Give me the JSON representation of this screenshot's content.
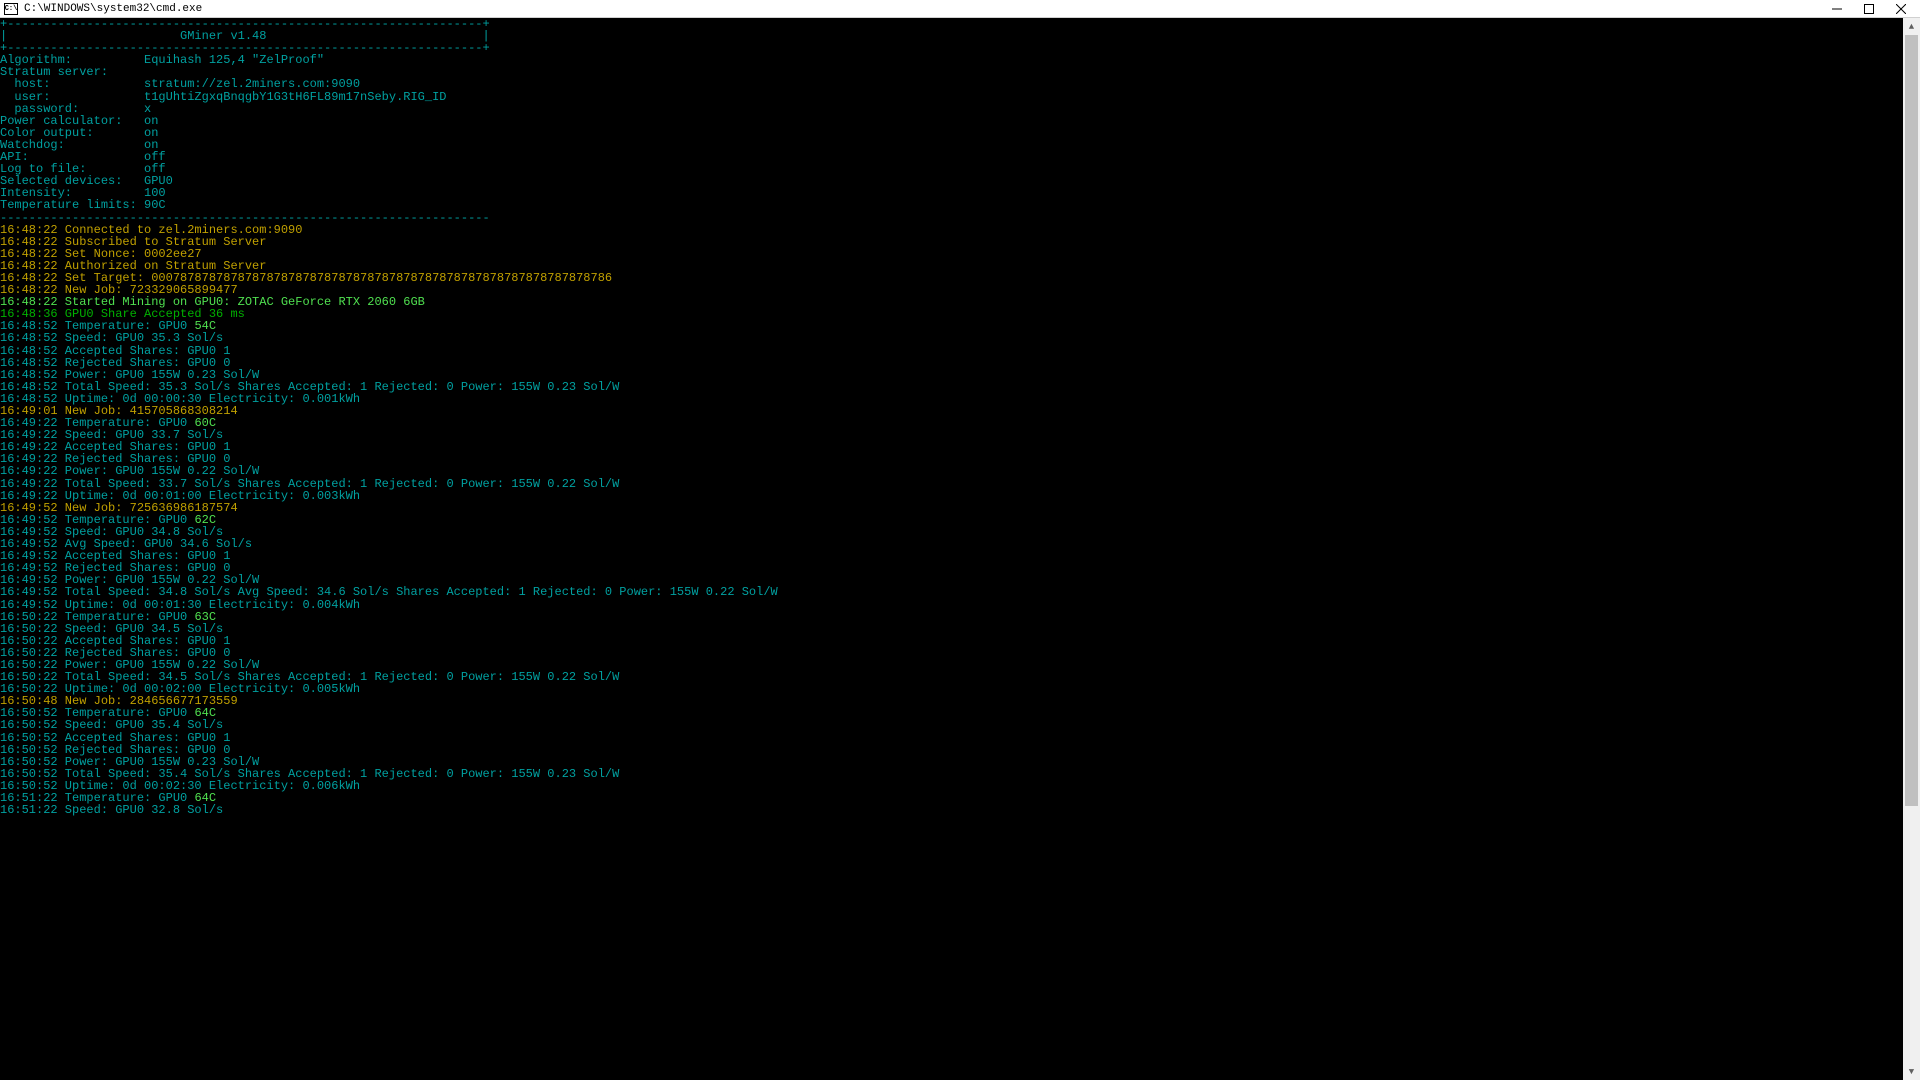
{
  "titlebar": {
    "icon_text": "C:\\",
    "title": "C:\\WINDOWS\\system32\\cmd.exe"
  },
  "banner": {
    "sep": "+------------------------------------------------------------------+",
    "mid": "|                        GMiner v1.48                              |"
  },
  "config_sep_top": "+------------------------------------------------------------------+",
  "config": [
    [
      "Algorithm:          ",
      "Equihash 125,4 \"ZelProof\""
    ],
    [
      "Stratum server:",
      ""
    ],
    [
      "  host:             ",
      "stratum://zel.2miners.com:9090"
    ],
    [
      "  user:             ",
      "t1gUhtiZgxqBnqgbY1G3tH6FL89m17nSeby.RIG_ID"
    ],
    [
      "  password:         ",
      "x"
    ],
    [
      "Power calculator:   ",
      "on"
    ],
    [
      "Color output:       ",
      "on"
    ],
    [
      "Watchdog:           ",
      "on"
    ],
    [
      "API:                ",
      "off"
    ],
    [
      "Log to file:        ",
      "off"
    ],
    [
      "Selected devices:   ",
      "GPU0"
    ],
    [
      "Intensity:          ",
      "100"
    ],
    [
      "Temperature limits: ",
      "90C"
    ]
  ],
  "config_sep_bottom": "--------------------------------------------------------------------",
  "log": [
    {
      "c": "yellow",
      "t": "16:48:22 Connected to zel.2miners.com:9090"
    },
    {
      "c": "yellow",
      "t": "16:48:22 Subscribed to Stratum Server"
    },
    {
      "c": "yellow",
      "t": "16:48:22 Set Nonce: 0002ee27"
    },
    {
      "c": "yellow",
      "t": "16:48:22 Authorized on Stratum Server"
    },
    {
      "c": "yellow",
      "t": "16:48:22 Set Target: 0007878787878787878787878787878787878787878787878787878787878786"
    },
    {
      "c": "yellow",
      "t": "16:48:22 New Job: 723329065899477"
    },
    {
      "c": "brgreen",
      "t": "16:48:22 Started Mining on GPU0: ZOTAC GeForce RTX 2060 6GB"
    },
    {
      "c": "green",
      "t": "16:48:36 GPU0 Share Accepted 36 ms"
    },
    {
      "c": "cyan",
      "pre": "16:48:52 Temperature: GPU0 ",
      "temp": "54C"
    },
    {
      "c": "cyan",
      "t": "16:48:52 Speed: GPU0 35.3 Sol/s"
    },
    {
      "c": "cyan",
      "t": "16:48:52 Accepted Shares: GPU0 1"
    },
    {
      "c": "cyan",
      "t": "16:48:52 Rejected Shares: GPU0 0"
    },
    {
      "c": "cyan",
      "t": "16:48:52 Power: GPU0 155W 0.23 Sol/W"
    },
    {
      "c": "cyan",
      "t": "16:48:52 Total Speed: 35.3 Sol/s Shares Accepted: 1 Rejected: 0 Power: 155W 0.23 Sol/W"
    },
    {
      "c": "cyan",
      "t": "16:48:52 Uptime: 0d 00:00:30 Electricity: 0.001kWh"
    },
    {
      "c": "yellow",
      "t": "16:49:01 New Job: 415705868308214"
    },
    {
      "c": "cyan",
      "pre": "16:49:22 Temperature: GPU0 ",
      "temp": "60C"
    },
    {
      "c": "cyan",
      "t": "16:49:22 Speed: GPU0 33.7 Sol/s"
    },
    {
      "c": "cyan",
      "t": "16:49:22 Accepted Shares: GPU0 1"
    },
    {
      "c": "cyan",
      "t": "16:49:22 Rejected Shares: GPU0 0"
    },
    {
      "c": "cyan",
      "t": "16:49:22 Power: GPU0 155W 0.22 Sol/W"
    },
    {
      "c": "cyan",
      "t": "16:49:22 Total Speed: 33.7 Sol/s Shares Accepted: 1 Rejected: 0 Power: 155W 0.22 Sol/W"
    },
    {
      "c": "cyan",
      "t": "16:49:22 Uptime: 0d 00:01:00 Electricity: 0.003kWh"
    },
    {
      "c": "yellow",
      "t": "16:49:52 New Job: 725636986187574"
    },
    {
      "c": "cyan",
      "pre": "16:49:52 Temperature: GPU0 ",
      "temp": "62C"
    },
    {
      "c": "cyan",
      "t": "16:49:52 Speed: GPU0 34.8 Sol/s"
    },
    {
      "c": "cyan",
      "t": "16:49:52 Avg Speed: GPU0 34.6 Sol/s"
    },
    {
      "c": "cyan",
      "t": "16:49:52 Accepted Shares: GPU0 1"
    },
    {
      "c": "cyan",
      "t": "16:49:52 Rejected Shares: GPU0 0"
    },
    {
      "c": "cyan",
      "t": "16:49:52 Power: GPU0 155W 0.22 Sol/W"
    },
    {
      "c": "cyan",
      "t": "16:49:52 Total Speed: 34.8 Sol/s Avg Speed: 34.6 Sol/s Shares Accepted: 1 Rejected: 0 Power: 155W 0.22 Sol/W"
    },
    {
      "c": "cyan",
      "t": "16:49:52 Uptime: 0d 00:01:30 Electricity: 0.004kWh"
    },
    {
      "c": "cyan",
      "pre": "16:50:22 Temperature: GPU0 ",
      "temp": "63C"
    },
    {
      "c": "cyan",
      "t": "16:50:22 Speed: GPU0 34.5 Sol/s"
    },
    {
      "c": "cyan",
      "t": "16:50:22 Accepted Shares: GPU0 1"
    },
    {
      "c": "cyan",
      "t": "16:50:22 Rejected Shares: GPU0 0"
    },
    {
      "c": "cyan",
      "t": "16:50:22 Power: GPU0 155W 0.22 Sol/W"
    },
    {
      "c": "cyan",
      "t": "16:50:22 Total Speed: 34.5 Sol/s Shares Accepted: 1 Rejected: 0 Power: 155W 0.22 Sol/W"
    },
    {
      "c": "cyan",
      "t": "16:50:22 Uptime: 0d 00:02:00 Electricity: 0.005kWh"
    },
    {
      "c": "yellow",
      "t": "16:50:48 New Job: 284656677173559"
    },
    {
      "c": "cyan",
      "pre": "16:50:52 Temperature: GPU0 ",
      "temp": "64C"
    },
    {
      "c": "cyan",
      "t": "16:50:52 Speed: GPU0 35.4 Sol/s"
    },
    {
      "c": "cyan",
      "t": "16:50:52 Accepted Shares: GPU0 1"
    },
    {
      "c": "cyan",
      "t": "16:50:52 Rejected Shares: GPU0 0"
    },
    {
      "c": "cyan",
      "t": "16:50:52 Power: GPU0 155W 0.23 Sol/W"
    },
    {
      "c": "cyan",
      "t": "16:50:52 Total Speed: 35.4 Sol/s Shares Accepted: 1 Rejected: 0 Power: 155W 0.23 Sol/W"
    },
    {
      "c": "cyan",
      "t": "16:50:52 Uptime: 0d 00:02:30 Electricity: 0.006kWh"
    },
    {
      "c": "cyan",
      "pre": "16:51:22 Temperature: GPU0 ",
      "temp": "64C"
    },
    {
      "c": "cyan",
      "t": "16:51:22 Speed: GPU0 32.8 Sol/s"
    }
  ]
}
